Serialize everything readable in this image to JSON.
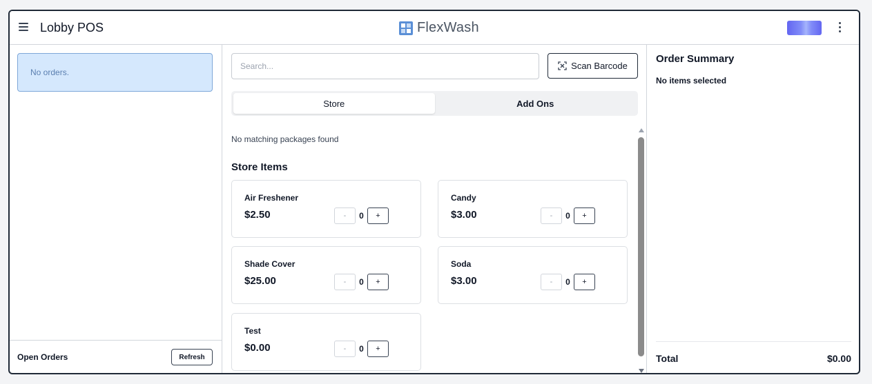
{
  "header": {
    "title": "Lobby POS",
    "brand_name": "FlexWash",
    "brand_color": "#5a8fd6",
    "menu_icon": "hamburger-menu-icon",
    "more_icon": "vertical-ellipsis-icon"
  },
  "orders_panel": {
    "empty_text": "No orders.",
    "footer_label": "Open Orders",
    "refresh_label": "Refresh"
  },
  "catalog": {
    "search_placeholder": "Search...",
    "scan_label": "Scan Barcode",
    "scan_icon": "barcode-scan-icon",
    "tabs": [
      {
        "label": "Store",
        "active": true
      },
      {
        "label": "Add Ons",
        "active": false
      }
    ],
    "empty_packages": "No matching packages found",
    "section_title": "Store Items",
    "minus_label": "-",
    "plus_label": "+",
    "items": [
      {
        "name": "Air Freshener",
        "price": "$2.50",
        "qty": "0"
      },
      {
        "name": "Candy",
        "price": "$3.00",
        "qty": "0"
      },
      {
        "name": "Shade Cover",
        "price": "$25.00",
        "qty": "0"
      },
      {
        "name": "Soda",
        "price": "$3.00",
        "qty": "0"
      },
      {
        "name": "Test",
        "price": "$0.00",
        "qty": "0"
      }
    ]
  },
  "summary": {
    "title": "Order Summary",
    "empty_text": "No items selected",
    "total_label": "Total",
    "total_value": "$0.00"
  }
}
